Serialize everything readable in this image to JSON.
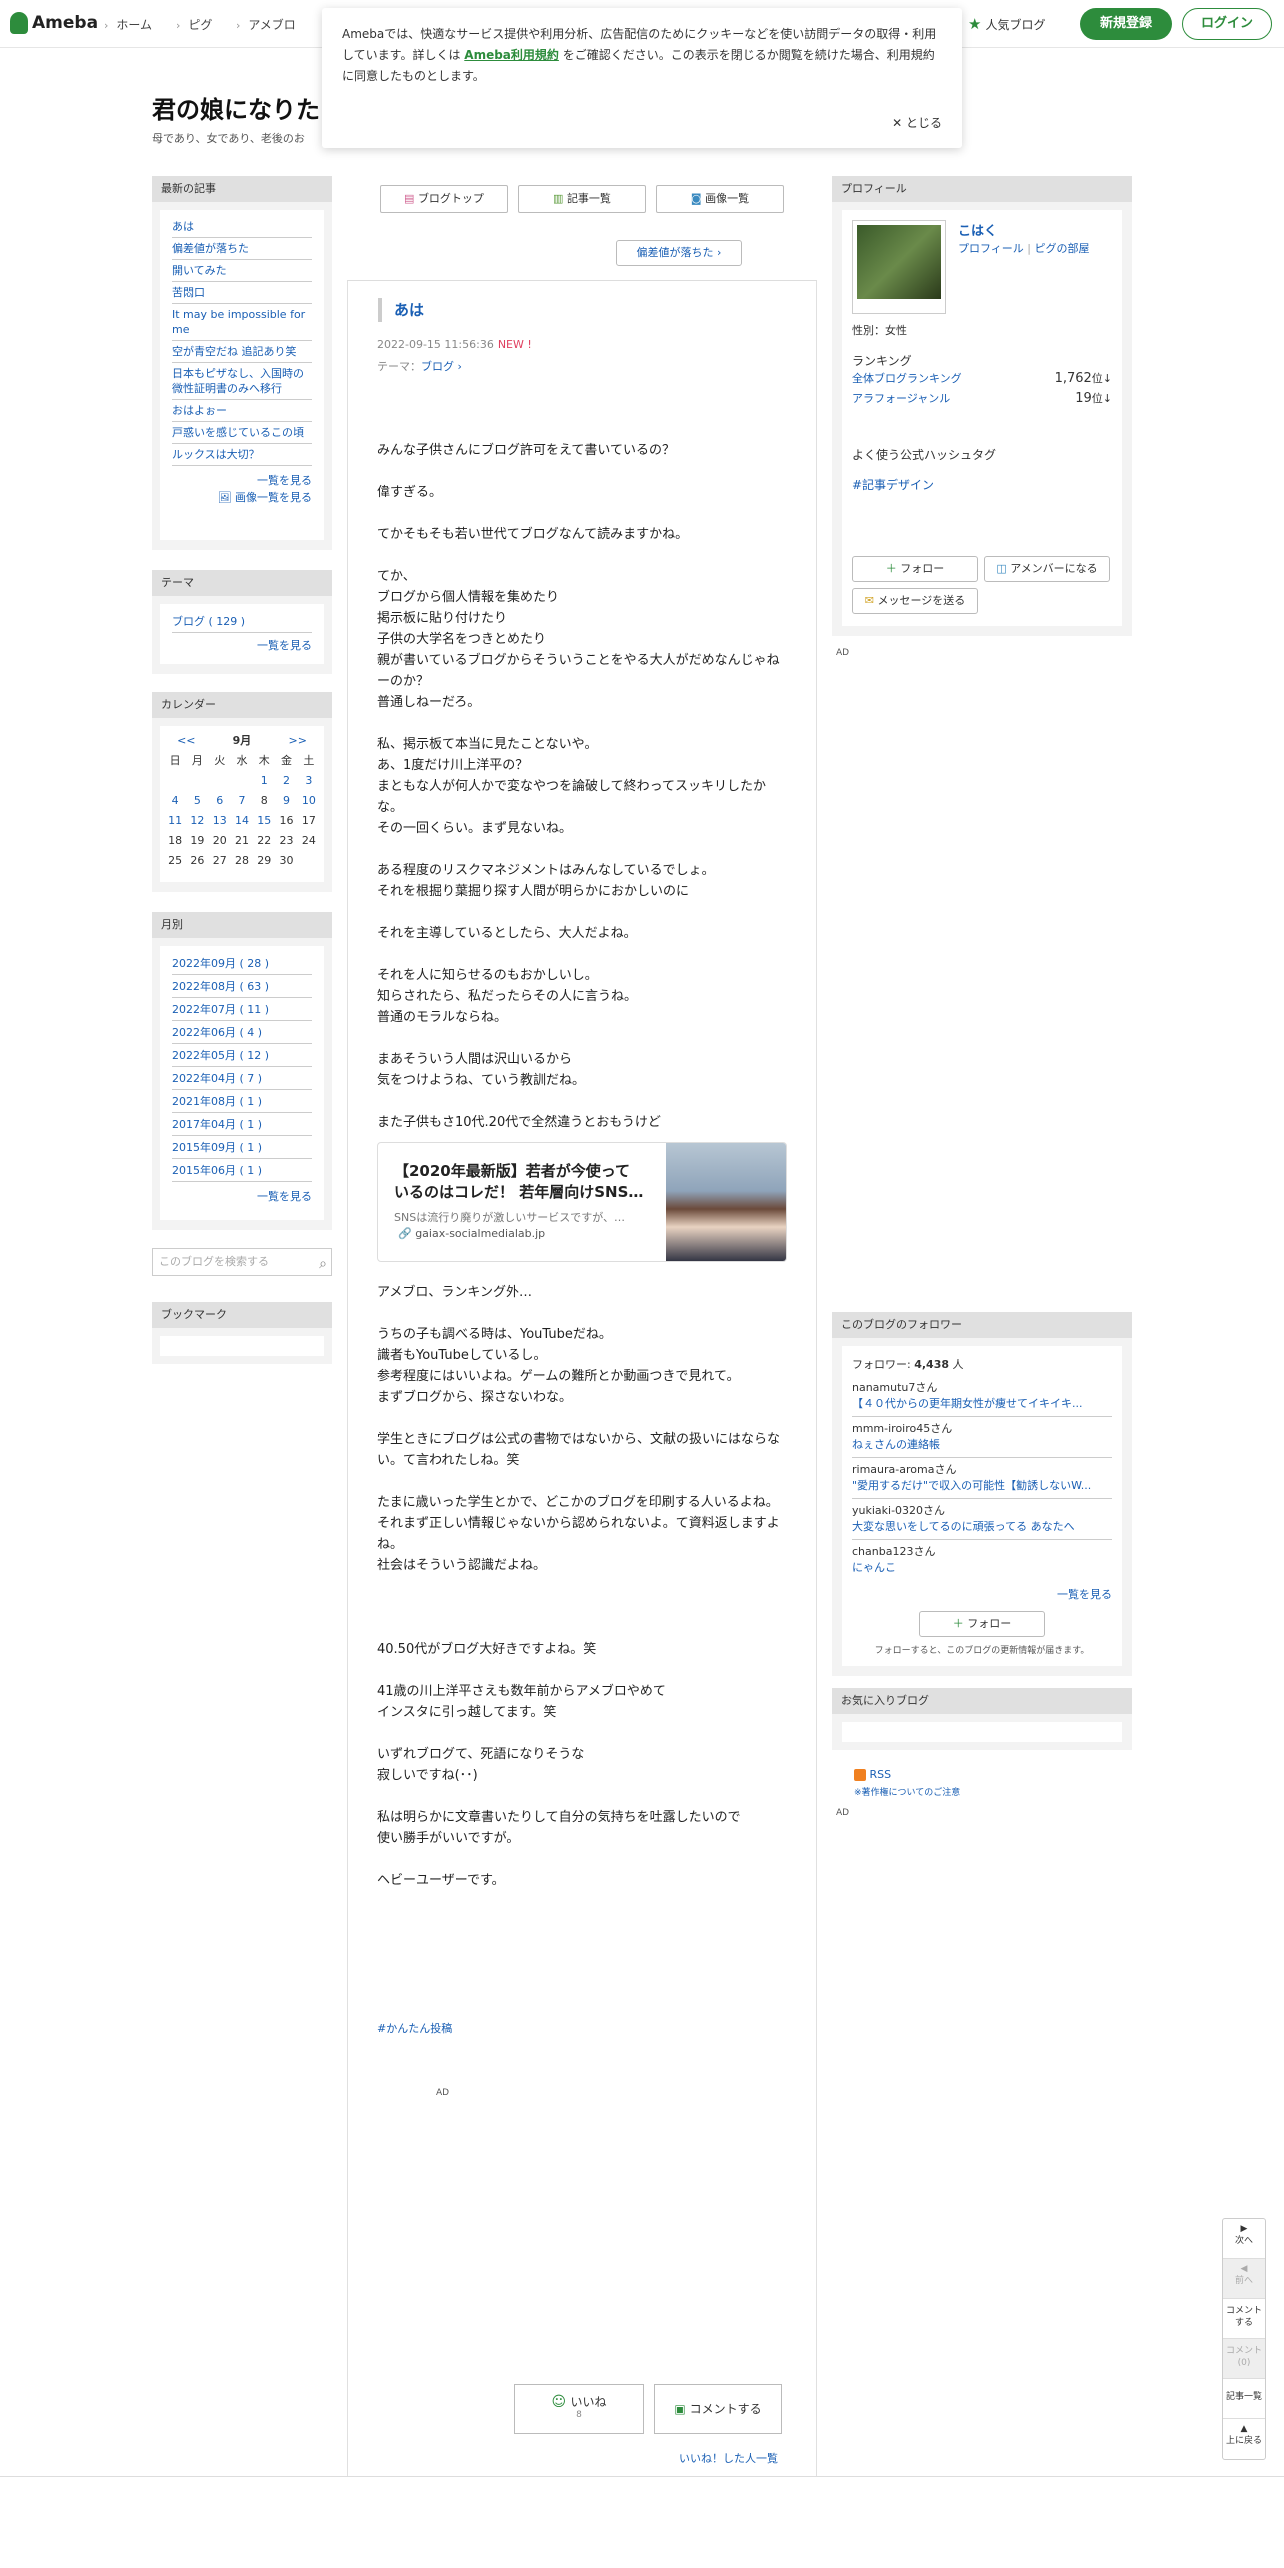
{
  "header": {
    "logo": "Ameba",
    "nav": [
      "ホーム",
      "ピグ",
      "アメブロ"
    ],
    "popular": "人気ブログ",
    "register": "新規登録",
    "login": "ログイン"
  },
  "cookie": {
    "text1": "Amebaでは、快適なサービス提供や利用分析、広告配信のためにクッキーなどを使い訪問データの取得・利用しています。詳しくは",
    "link": "Ameba利用規約",
    "text2": "をご確認ください。この表示を閉じるか閲覧を続けた場合、利用規約に同意したものとします。",
    "close": "とじる"
  },
  "blog": {
    "title": "君の娘になりた",
    "subtitle": "母であり、女であり、老後のお"
  },
  "left": {
    "latest_heading": "最新の記事",
    "articles": [
      "あは",
      "偏差値が落ちた",
      "開いてみた",
      "苦悶口",
      "It may be impossible for me",
      "空が青空だね 追記あり笑",
      "日本もピザなし、入国時の微性証明書のみへ移行",
      "おはよぉー",
      "戸惑いを感じているこの頃",
      "ルックスは大切？"
    ],
    "more": "一覧を見る",
    "image_more": "画像一覧を見る",
    "theme_heading": "テーマ",
    "theme_item": "ブログ ( 129 )",
    "theme_more": "一覧を見る",
    "calendar_heading": "カレンダー",
    "calendar": {
      "prev": "<<",
      "month": "9月",
      "next": ">>",
      "weekdays": [
        "日",
        "月",
        "火",
        "水",
        "木",
        "金",
        "土"
      ],
      "rows": [
        [
          "",
          "",
          "",
          "",
          "1",
          "2",
          "3"
        ],
        [
          "4",
          "5",
          "6",
          "7",
          "8",
          "9",
          "10"
        ],
        [
          "11",
          "12",
          "13",
          "14",
          "15",
          "16",
          "17"
        ],
        [
          "18",
          "19",
          "20",
          "21",
          "22",
          "23",
          "24"
        ],
        [
          "25",
          "26",
          "27",
          "28",
          "29",
          "30",
          ""
        ]
      ],
      "linked": [
        "1",
        "2",
        "3",
        "4",
        "5",
        "6",
        "7",
        "9",
        "10",
        "11",
        "12",
        "13",
        "14",
        "15"
      ]
    },
    "monthly_heading": "月別",
    "months": [
      "2022年09月 ( 28 )",
      "2022年08月 ( 63 )",
      "2022年07月 ( 11 )",
      "2022年06月 ( 4 )",
      "2022年05月 ( 12 )",
      "2022年04月 ( 7 )",
      "2021年08月 ( 1 )",
      "2017年04月 ( 1 )",
      "2015年09月 ( 1 )",
      "2015年06月 ( 1 )"
    ],
    "monthly_more": "一覧を見る",
    "search_placeholder": "このブログを検索する",
    "bookmark_heading": "ブックマーク"
  },
  "main": {
    "tabs": [
      "ブログトップ",
      "記事一覧",
      "画像一覧"
    ],
    "prev": "偏差値が落ちた",
    "title": "あは",
    "date": "2022-09-15 11:56:36",
    "new": "NEW !",
    "theme_label": "テーマ：",
    "theme": "ブログ",
    "paragraphs": [
      [
        "みんな子供さんにブログ許可をえて書いているの？"
      ],
      [
        "偉すぎる。"
      ],
      [
        "てかそもそも若い世代てブログなんて読みますかね。"
      ],
      [
        "てか、",
        "ブログから個人情報を集めたり",
        "掲示板に貼り付けたり",
        "子供の大学名をつきとめたり",
        "親が書いているブログからそういうことをやる大人がだめなんじゃねーのか？",
        "普通しねーだろ。"
      ],
      [
        "私、掲示板て本当に見たことないや。",
        "あ、1度だけ川上洋平の？",
        "まともな人が何人かで変なやつを論破して終わってスッキリしたかな。",
        "その一回くらい。まず見ないね。"
      ],
      [
        "ある程度のリスクマネジメントはみんなしているでしょ。",
        "それを根掘り葉掘り探す人間が明らかにおかしいのに"
      ],
      [
        "それを主導しているとしたら、大人だよね。"
      ],
      [
        "それを人に知らせるのもおかしいし。",
        "知らされたら、私だったらその人に言うね。",
        "普通のモラルならね。"
      ],
      [
        "まあそういう人間は沢山いるから",
        "気をつけようね、ていう教訓だね。"
      ],
      [
        "また子供もさ10代.20代で全然違うとおもうけど"
      ]
    ],
    "card": {
      "title": "【2020年最新版】若者が今使っているのはコレだ！ 若年層向けSNS…",
      "desc": "SNSは流行り廃りが激しいサービスですが、…",
      "site": "gaiax-socialmedialab.jp"
    },
    "paragraphs2": [
      [
        "アメブロ、ランキング外…"
      ],
      [
        "うちの子も調べる時は、YouTubeだね。",
        "識者もYouTubeしているし。",
        "参考程度にはいいよね。ゲームの難所とか動画つきで見れて。",
        "まずブログから、探さないわな。"
      ],
      [
        "学生ときにブログは公式の書物ではないから、文献の扱いにはならない。て言われたしね。笑"
      ],
      [
        "たまに歳いった学生とかで、どこかのブログを印刷する人いるよね。",
        "それまず正しい情報じゃないから認められないよ。て資料返しますよね。",
        "社会はそういう認識だよね。"
      ],
      [
        ""
      ],
      [
        "40.50代がブログ大好きですよね。笑"
      ],
      [
        "41歳の川上洋平さえも数年前からアメブロやめて",
        "インスタに引っ越してます。笑"
      ],
      [
        "いずれブログて、死語になりそうな",
        "寂しいですね(･･)"
      ],
      [
        "私は明らかに文章書いたりして自分の気持ちを吐露したいので",
        "使い勝手がいいですが。"
      ],
      [
        "ヘビーユーザーです。"
      ]
    ],
    "hashtag": "#かんたん投稿",
    "ad": "AD",
    "like": "いいね",
    "like_count": "8",
    "comment": "コメントする",
    "liked_list": "いいね！した人一覧"
  },
  "right": {
    "profile_heading": "プロフィール",
    "name": "こはく",
    "profile_link": "プロフィール",
    "pig_link": "ピグの部屋",
    "gender": "性別：女性",
    "ranking": "ランキング",
    "rank_overall_label": "全体ブログランキング",
    "rank_overall": "1,762",
    "rank_genre_label": "アラフォージャンル",
    "rank_genre": "19",
    "rank_unit": "位",
    "hashtag_label": "よく使う公式ハッシュタグ",
    "hashtag": "#記事デザイン",
    "follow": "フォロー",
    "member": "アメンバーになる",
    "message": "メッセージを送る",
    "ad": "AD",
    "followers_heading": "このブログのフォロワー",
    "followers_label": "フォロワー:",
    "followers_count": "4,438",
    "followers_unit": "人",
    "followers": [
      {
        "name": "nanamutu7さん",
        "desc": "【４０代からの更年期女性が痩せてイキイキ..."
      },
      {
        "name": "mmm-iroiro45さん",
        "desc": "ねぇさんの連絡帳"
      },
      {
        "name": "rimaura-aromaさん",
        "desc": "\"愛用するだけ\"で収入の可能性【勧誘しないW..."
      },
      {
        "name": "yukiaki-0320さん",
        "desc": "大変な思いをしてるのに頑張ってる あなたへ"
      },
      {
        "name": "chanba123さん",
        "desc": "にゃんこ"
      }
    ],
    "followers_more": "一覧を見る",
    "follow2": "フォロー",
    "follow_note": "フォローすると、このブログの更新情報が届きます。",
    "favorites_heading": "お気に入りブログ",
    "rss": "RSS",
    "copyright": "※著作権についてのご注意",
    "ad2": "AD"
  },
  "floatnav": [
    "次へ",
    "前へ",
    "コメントする",
    "コメント(0)",
    "記事一覧",
    "上に戻る"
  ],
  "colors": {
    "brand": "#2d8c3c",
    "link": "#1a5fb4",
    "new": "#e04060"
  }
}
